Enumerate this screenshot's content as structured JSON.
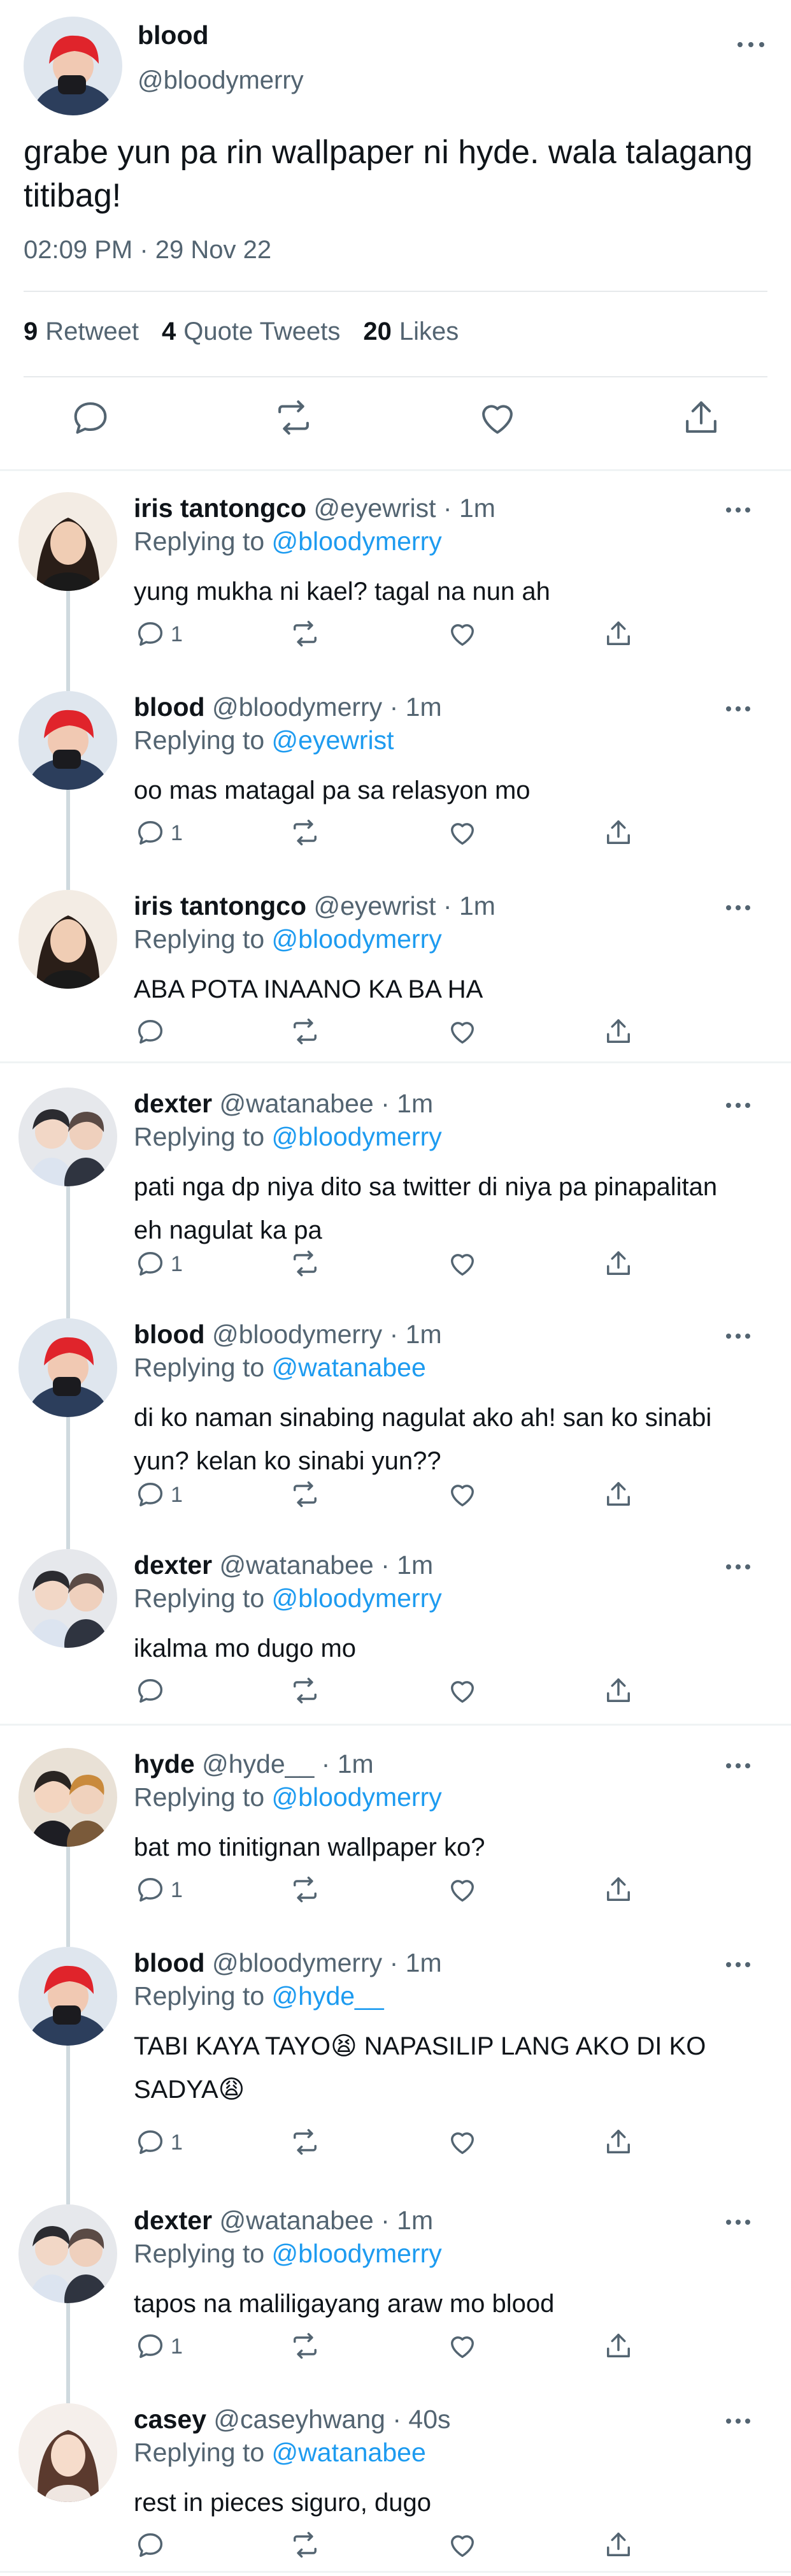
{
  "tweet": {
    "name": "blood",
    "handle": "@bloodymerry",
    "text": "grabe yun pa rin wallpaper ni hyde. wala talagang titibag!",
    "timestamp": "02:09 PM · 29 Nov 22",
    "stats": [
      {
        "count": "9",
        "label": "Retweet"
      },
      {
        "count": "4",
        "label": "Quote Tweets"
      },
      {
        "count": "20",
        "label": "Likes"
      }
    ],
    "actions": [
      "reply-icon",
      "retweet-icon",
      "like-icon",
      "share-icon"
    ]
  },
  "replying_prefix": "Replying to",
  "replies": [
    {
      "name": "iris tantongco",
      "handle": "@eyewrist",
      "time": "1m",
      "replying_to": "@bloodymerry",
      "text": "yung mukha ni kael? tagal na nun ah",
      "reply_count": "1",
      "avatar": "iris"
    },
    {
      "name": "blood",
      "handle": "@bloodymerry",
      "time": "1m",
      "replying_to": "@eyewrist",
      "text": "oo mas matagal pa sa relasyon mo",
      "reply_count": "1",
      "avatar": "blood"
    },
    {
      "name": "iris tantongco",
      "handle": "@eyewrist",
      "time": "1m",
      "replying_to": "@bloodymerry",
      "text": "ABA POTA INAANO KA BA HA",
      "reply_count": "",
      "avatar": "iris"
    },
    {
      "name": "dexter",
      "handle": "@watanabee",
      "time": "1m",
      "replying_to": "@bloodymerry",
      "text": "pati nga dp niya dito sa twitter di niya pa pinapalitan eh nagulat ka pa",
      "reply_count": "1",
      "avatar": "dexter"
    },
    {
      "name": "blood",
      "handle": "@bloodymerry",
      "time": "1m",
      "replying_to": "@watanabee",
      "text": "di ko naman sinabing nagulat ako ah! san ko sinabi yun? kelan ko sinabi yun??",
      "reply_count": "1",
      "avatar": "blood"
    },
    {
      "name": "dexter",
      "handle": "@watanabee",
      "time": "1m",
      "replying_to": "@bloodymerry",
      "text": "ikalma mo dugo mo",
      "reply_count": "",
      "avatar": "dexter"
    },
    {
      "name": "hyde",
      "handle": "@hyde__",
      "time": "1m",
      "replying_to": "@bloodymerry",
      "text": "bat mo tinitignan wallpaper ko?",
      "reply_count": "1",
      "avatar": "hyde"
    },
    {
      "name": "blood",
      "handle": "@bloodymerry",
      "time": "1m",
      "replying_to": "@hyde__",
      "text": "TABI KAYA TAYO😫  NAPASILIP LANG AKO DI KO SADYA😩",
      "reply_count": "1",
      "avatar": "blood"
    },
    {
      "name": "dexter",
      "handle": "@watanabee",
      "time": "1m",
      "replying_to": "@bloodymerry",
      "text": "tapos na maliligayang araw mo blood",
      "reply_count": "1",
      "avatar": "dexter"
    },
    {
      "name": "casey",
      "handle": "@caseyhwang",
      "time": "40s",
      "replying_to": "@watanabee",
      "text": "rest in pieces siguro, dugo",
      "reply_count": "",
      "avatar": "casey"
    }
  ],
  "colors": {
    "accent": "#1d9bf0",
    "text": "#0f1419",
    "secondary": "#536471",
    "thread_line": "#cfd9de",
    "divider": "#eff3f4"
  }
}
